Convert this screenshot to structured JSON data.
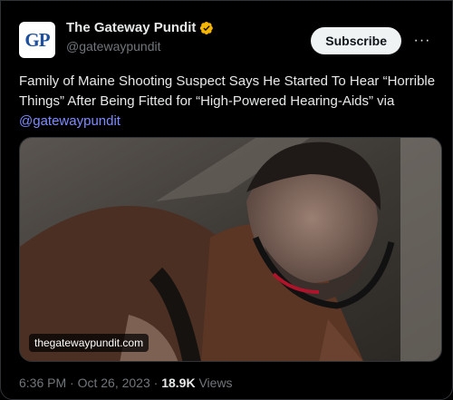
{
  "account": {
    "avatar_text": "GP",
    "display_name": "The Gateway Pundit",
    "handle": "@gatewaypundit",
    "verified_icon": "gold-verified-badge-icon"
  },
  "actions": {
    "subscribe_label": "Subscribe",
    "more_label": "···"
  },
  "tweet": {
    "text": "Family of Maine Shooting Suspect Says He Started To Hear “Horrible Things” After Being Fitted for “High-Powered Hearing-Aids” via ",
    "mention": "@gatewaypundit"
  },
  "media": {
    "watermark": "thegatewaypundit.com"
  },
  "meta": {
    "time": "6:36 PM",
    "separator": " · ",
    "date": "Oct 26, 2023",
    "views_count": "18.9K",
    "views_label": "Views"
  },
  "colors": {
    "background": "#000000",
    "accent_link": "#7e8cff",
    "muted": "#71767b",
    "badge": "#f4b400",
    "avatar_text": "#1d4f9c"
  }
}
